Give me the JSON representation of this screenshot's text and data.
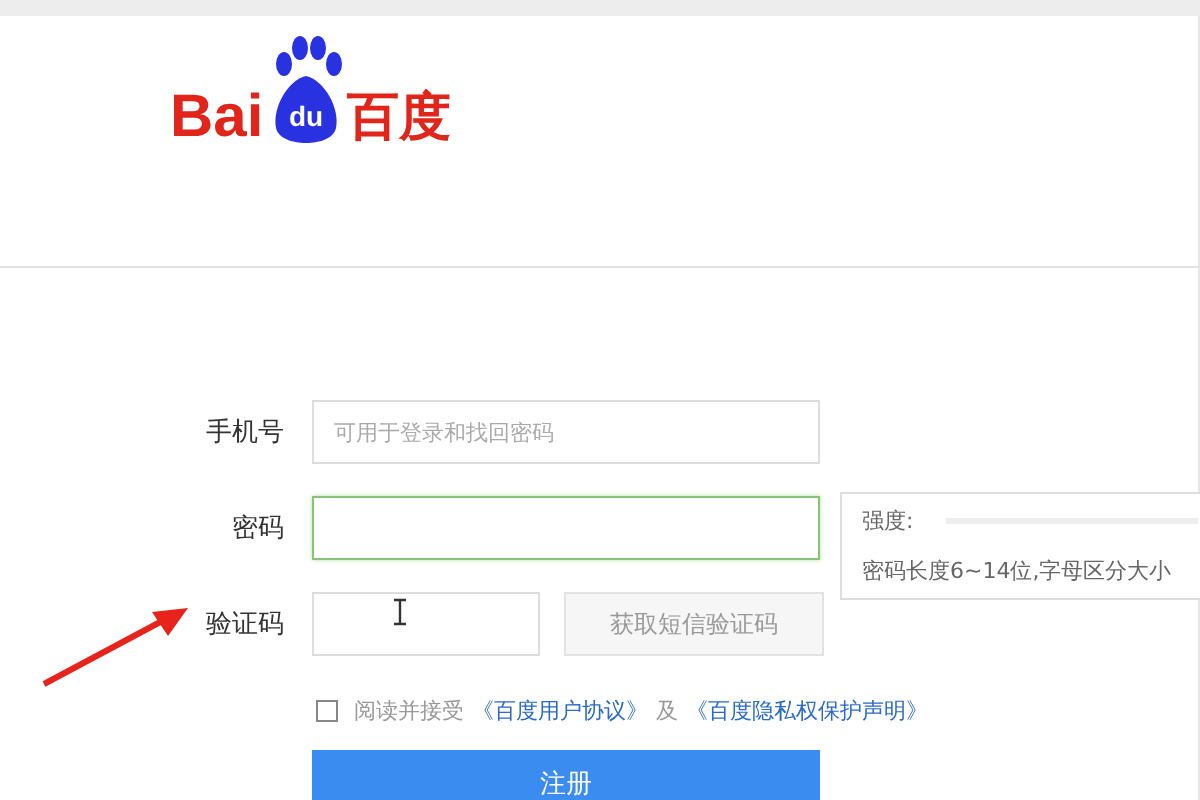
{
  "logo": {
    "latin": "Bai",
    "badge": "du",
    "chinese": "百度"
  },
  "form": {
    "fields": [
      {
        "label": "手机号",
        "placeholder": "可用于登录和找回密码",
        "focused": false
      },
      {
        "label": "密码",
        "focused": true
      }
    ],
    "captcha": {
      "label": "验证码",
      "button": "获取短信验证码"
    },
    "strength_tip": {
      "label": "强度:",
      "hint": "密码长度6~14位,字母区分大小"
    },
    "agreement": {
      "checked": false,
      "text": "阅读并接受",
      "link1": "《百度用户协议》",
      "joiner": "及",
      "link2": "《百度隐私权保护声明》"
    },
    "submit": "注册"
  }
}
